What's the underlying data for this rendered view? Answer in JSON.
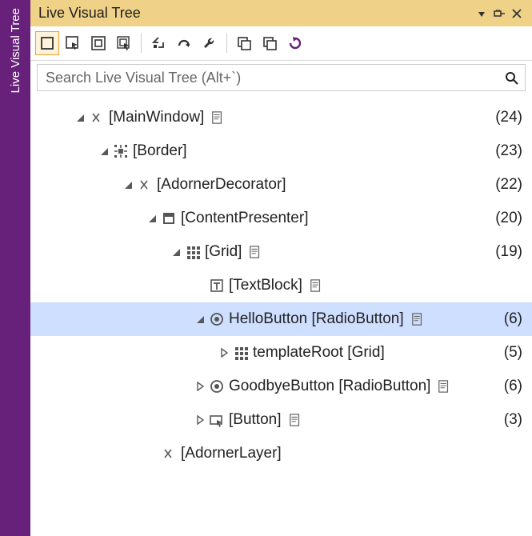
{
  "side_tab": {
    "label": "Live Visual Tree"
  },
  "titlebar": {
    "title": "Live Visual Tree",
    "menu_icon": "window-position-icon",
    "pin_icon": "pin-icon",
    "close_icon": "close-icon"
  },
  "toolbar": {
    "items": [
      {
        "name": "toolbar-show-in-app",
        "icon": "rect",
        "active": true
      },
      {
        "name": "toolbar-enable-selection",
        "icon": "select-rect"
      },
      {
        "name": "toolbar-layout-adorners",
        "icon": "nested-rect"
      },
      {
        "name": "toolbar-track-focus",
        "icon": "select-nested"
      },
      {
        "sep": true
      },
      {
        "name": "toolbar-collapse",
        "icon": "collapse-arrow"
      },
      {
        "name": "toolbar-undo",
        "icon": "undo-arrow"
      },
      {
        "name": "toolbar-wrench",
        "icon": "wrench"
      },
      {
        "sep": true
      },
      {
        "name": "toolbar-cascade-a",
        "icon": "cascade"
      },
      {
        "name": "toolbar-cascade-b",
        "icon": "cascade"
      },
      {
        "name": "toolbar-refresh",
        "icon": "refresh",
        "accent": true
      }
    ]
  },
  "search": {
    "placeholder": "Search Live Visual Tree (Alt+`)"
  },
  "tree": [
    {
      "indent": 0,
      "toggle": "expanded",
      "icon": "angle",
      "label": "[MainWindow]",
      "src": true,
      "count": "(24)"
    },
    {
      "indent": 1,
      "toggle": "expanded",
      "icon": "border",
      "label": "[Border]",
      "count": "(23)"
    },
    {
      "indent": 2,
      "toggle": "expanded",
      "icon": "angle",
      "label": "[AdornerDecorator]",
      "count": "(22)"
    },
    {
      "indent": 3,
      "toggle": "expanded",
      "icon": "content",
      "label": "[ContentPresenter]",
      "count": "(20)"
    },
    {
      "indent": 4,
      "toggle": "expanded",
      "icon": "grid",
      "label": "[Grid]",
      "src": true,
      "count": "(19)"
    },
    {
      "indent": 5,
      "toggle": "blank",
      "icon": "text",
      "label": "[TextBlock]",
      "src": true
    },
    {
      "indent": 5,
      "toggle": "expanded",
      "icon": "radio",
      "label": "HelloButton [RadioButton]",
      "src": true,
      "count": "(6)",
      "selected": true
    },
    {
      "indent": 6,
      "toggle": "collapsed",
      "icon": "grid",
      "label": "templateRoot [Grid]",
      "count": "(5)"
    },
    {
      "indent": 5,
      "toggle": "collapsed",
      "icon": "radio",
      "label": "GoodbyeButton [RadioButton]",
      "src": true,
      "count": "(6)"
    },
    {
      "indent": 5,
      "toggle": "collapsed",
      "icon": "button",
      "label": "[Button]",
      "src": true,
      "count": "(3)"
    },
    {
      "indent": 3,
      "toggle": "blank",
      "icon": "angle",
      "label": "[AdornerLayer]"
    }
  ]
}
